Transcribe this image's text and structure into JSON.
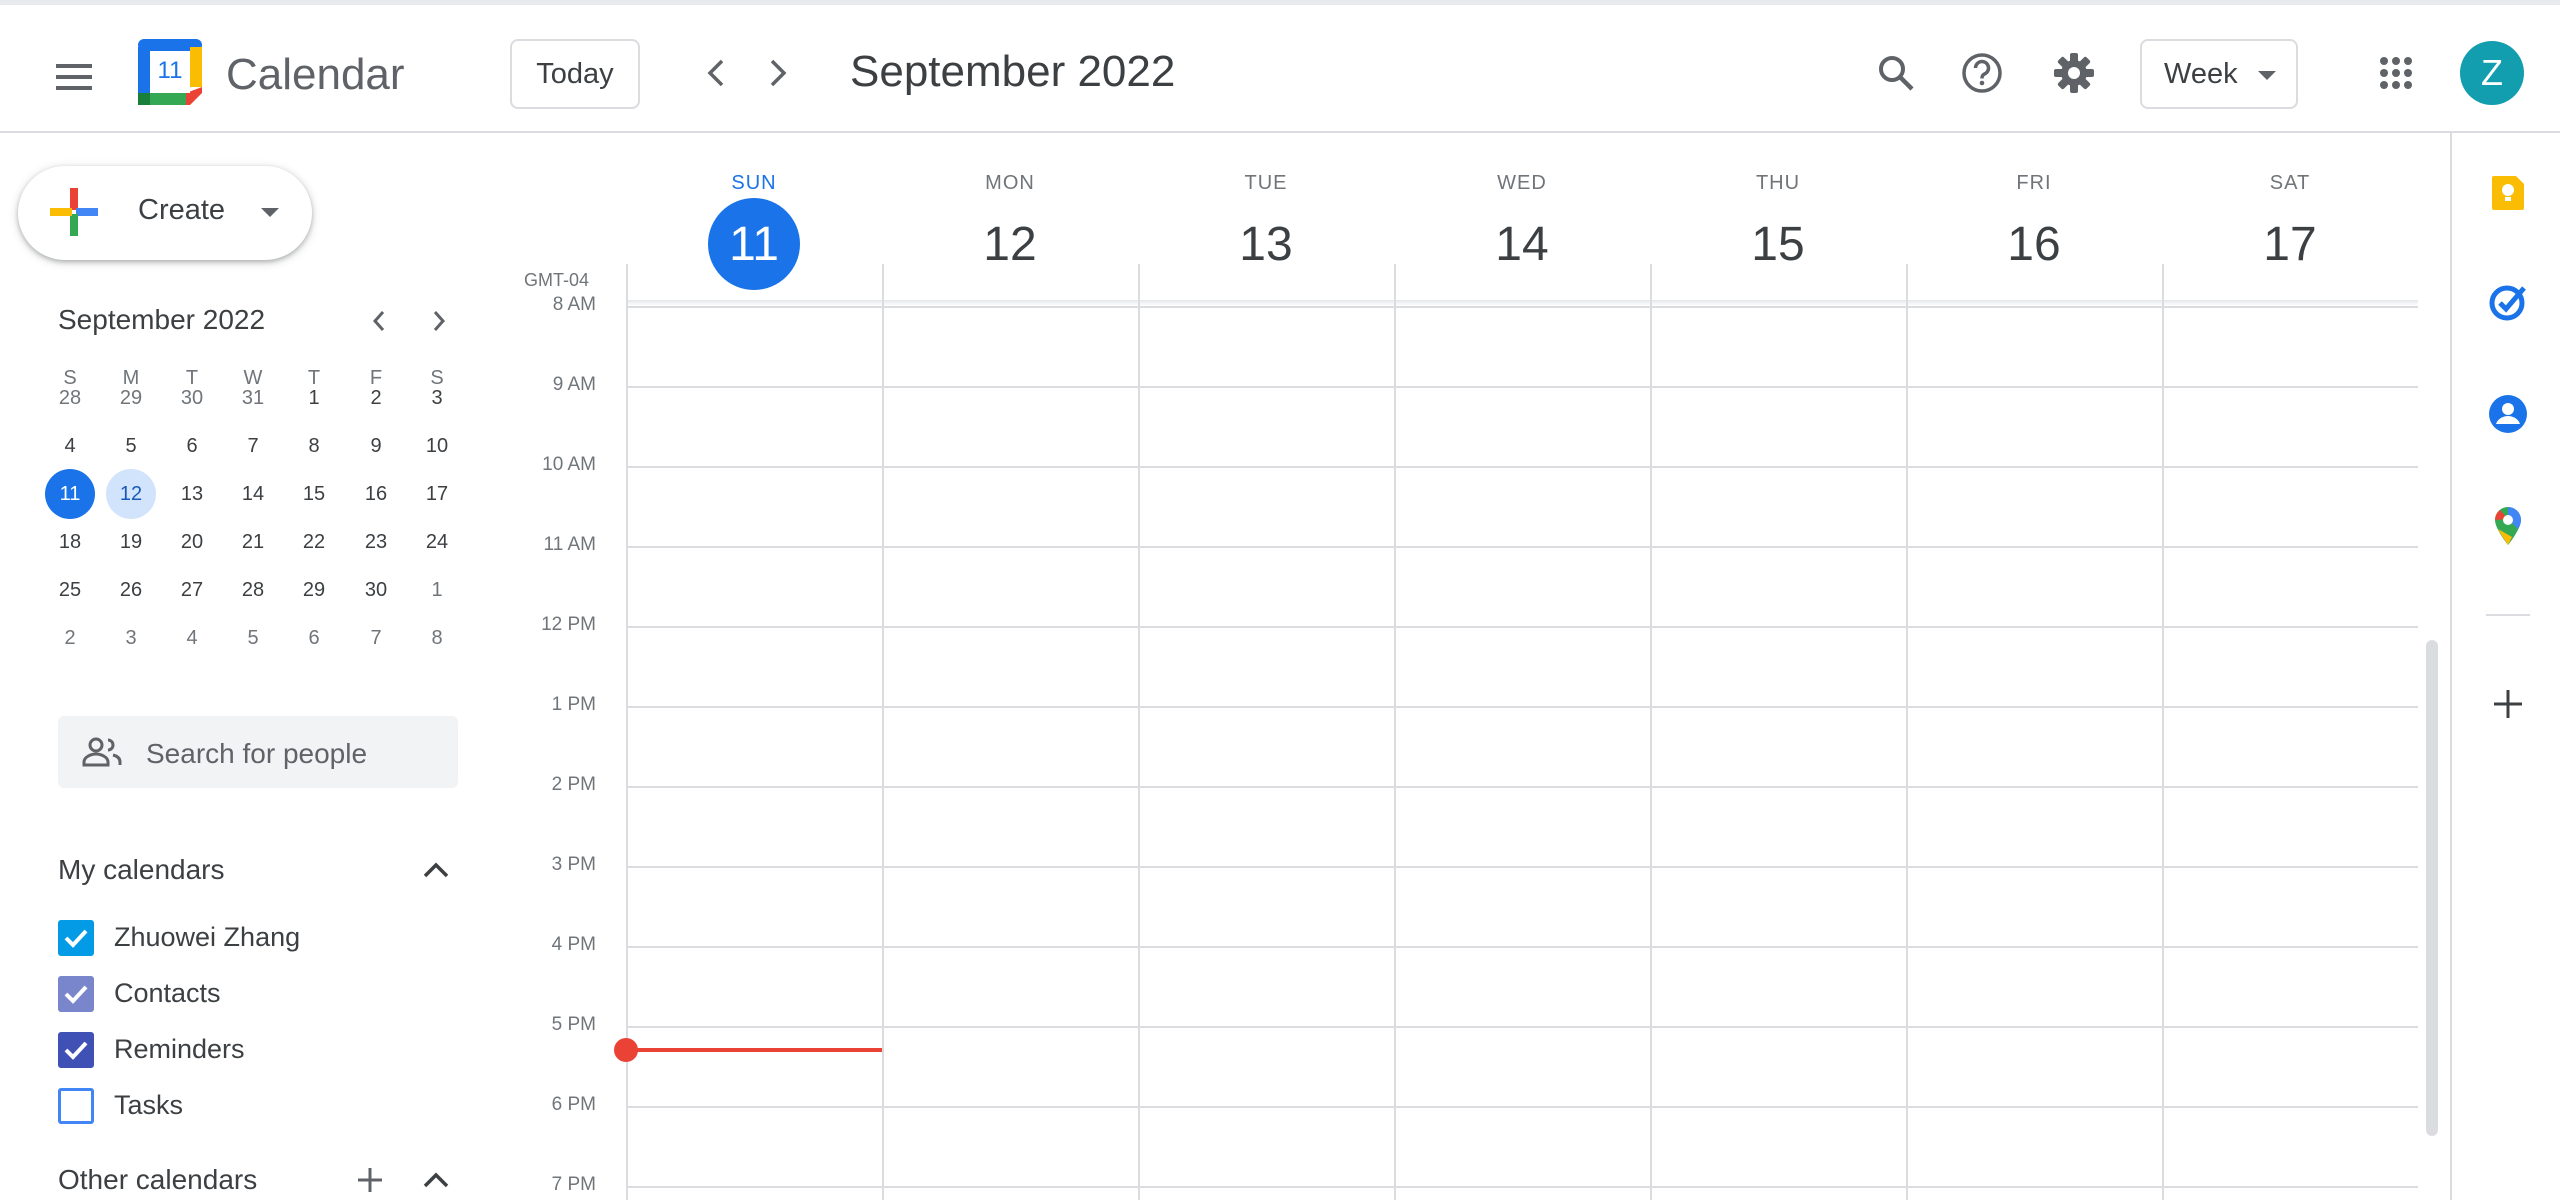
{
  "header": {
    "app_name": "Calendar",
    "logo_day": "11",
    "today_label": "Today",
    "range_title": "September 2022",
    "view_label": "Week",
    "avatar_initial": "Z"
  },
  "create": {
    "label": "Create"
  },
  "mini_calendar": {
    "title": "September 2022",
    "weekdays": [
      "S",
      "M",
      "T",
      "W",
      "T",
      "F",
      "S"
    ],
    "weeks": [
      [
        {
          "d": "28",
          "o": true
        },
        {
          "d": "29",
          "o": true
        },
        {
          "d": "30",
          "o": true
        },
        {
          "d": "31",
          "o": true
        },
        {
          "d": "1"
        },
        {
          "d": "2"
        },
        {
          "d": "3"
        }
      ],
      [
        {
          "d": "4"
        },
        {
          "d": "5"
        },
        {
          "d": "6"
        },
        {
          "d": "7"
        },
        {
          "d": "8"
        },
        {
          "d": "9"
        },
        {
          "d": "10"
        }
      ],
      [
        {
          "d": "11",
          "today": true
        },
        {
          "d": "12",
          "sel": true
        },
        {
          "d": "13"
        },
        {
          "d": "14"
        },
        {
          "d": "15"
        },
        {
          "d": "16"
        },
        {
          "d": "17"
        }
      ],
      [
        {
          "d": "18"
        },
        {
          "d": "19"
        },
        {
          "d": "20"
        },
        {
          "d": "21"
        },
        {
          "d": "22"
        },
        {
          "d": "23"
        },
        {
          "d": "24"
        }
      ],
      [
        {
          "d": "25"
        },
        {
          "d": "26"
        },
        {
          "d": "27"
        },
        {
          "d": "28"
        },
        {
          "d": "29"
        },
        {
          "d": "30"
        },
        {
          "d": "1",
          "o": true
        }
      ],
      [
        {
          "d": "2",
          "o": true
        },
        {
          "d": "3",
          "o": true
        },
        {
          "d": "4",
          "o": true
        },
        {
          "d": "5",
          "o": true
        },
        {
          "d": "6",
          "o": true
        },
        {
          "d": "7",
          "o": true
        },
        {
          "d": "8",
          "o": true
        }
      ]
    ]
  },
  "people_search": {
    "placeholder": "Search for people"
  },
  "my_calendars": {
    "title": "My calendars",
    "items": [
      {
        "label": "Zhuowei Zhang",
        "checked": true,
        "color": "#039be5"
      },
      {
        "label": "Contacts",
        "checked": true,
        "color": "#7986cb"
      },
      {
        "label": "Reminders",
        "checked": true,
        "color": "#3f51b5"
      },
      {
        "label": "Tasks",
        "checked": false,
        "color": "#4285f4"
      }
    ]
  },
  "other_calendars": {
    "title": "Other calendars"
  },
  "week": {
    "timezone": "GMT-04",
    "days": [
      {
        "dow": "SUN",
        "num": "11",
        "current": true
      },
      {
        "dow": "MON",
        "num": "12"
      },
      {
        "dow": "TUE",
        "num": "13"
      },
      {
        "dow": "WED",
        "num": "14"
      },
      {
        "dow": "THU",
        "num": "15"
      },
      {
        "dow": "FRI",
        "num": "16"
      },
      {
        "dow": "SAT",
        "num": "17"
      }
    ],
    "hours": [
      "8 AM",
      "9 AM",
      "10 AM",
      "11 AM",
      "12 PM",
      "1 PM",
      "2 PM",
      "3 PM",
      "4 PM",
      "5 PM",
      "6 PM",
      "7 PM"
    ]
  },
  "colors": {
    "accent": "#1a73e8",
    "now_indicator": "#ea4335",
    "grid_line": "#dadce0"
  }
}
